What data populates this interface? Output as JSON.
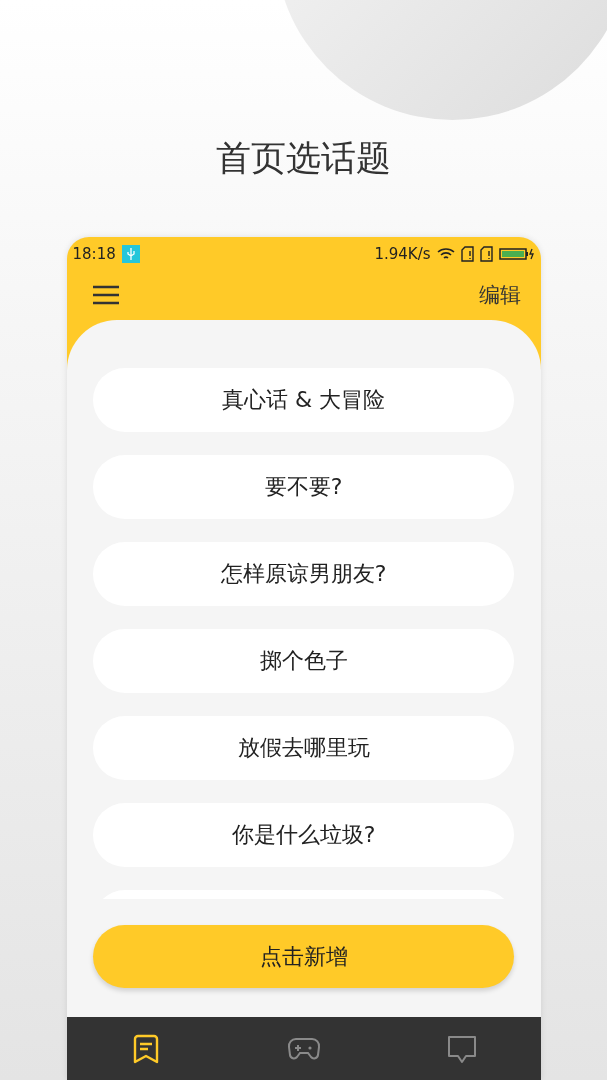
{
  "page_title": "首页选话题",
  "status_bar": {
    "time": "18:18",
    "speed": "1.94K/s"
  },
  "app_bar": {
    "action": "编辑"
  },
  "topics": [
    {
      "label": "真心话 & 大冒险"
    },
    {
      "label": "要不要?"
    },
    {
      "label": "怎样原谅男朋友?"
    },
    {
      "label": "掷个色子"
    },
    {
      "label": "放假去哪里玩"
    },
    {
      "label": "你是什么垃圾?"
    }
  ],
  "add_button": "点击新增",
  "nav": [
    {
      "kind": "topics",
      "selected": true
    },
    {
      "kind": "game",
      "selected": false
    },
    {
      "kind": "chat",
      "selected": false
    }
  ]
}
